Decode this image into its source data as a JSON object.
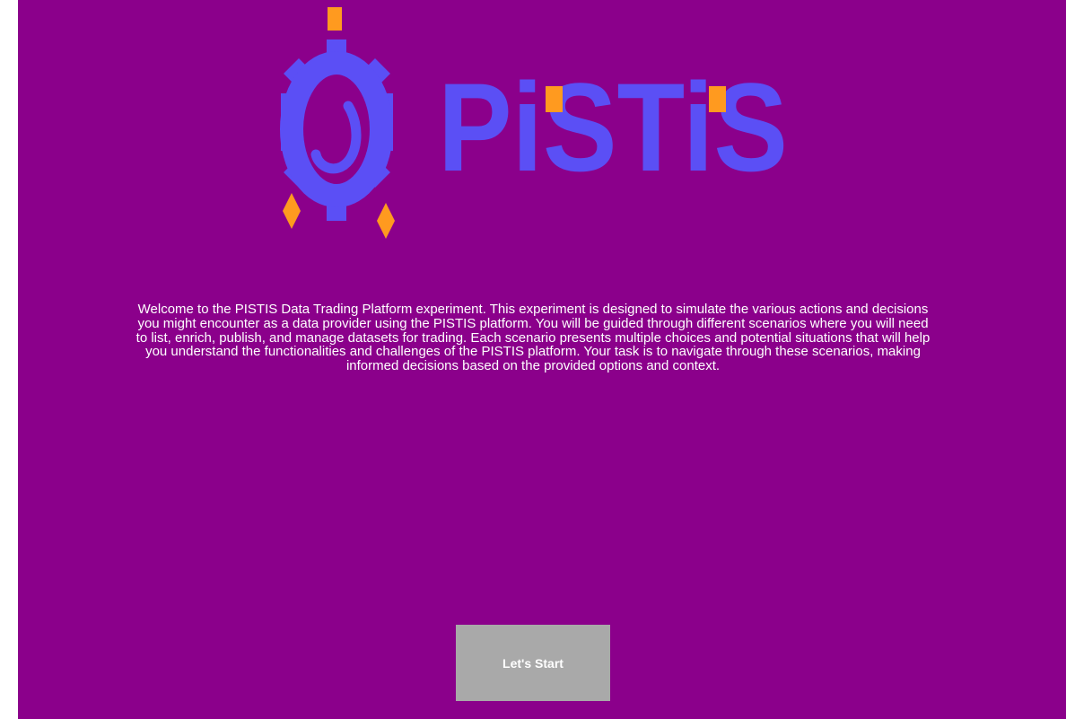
{
  "page": {
    "background_color": "#8b008b"
  },
  "logo": {
    "wordmark": "PiSTiS",
    "brand_color": "#5b4ff5",
    "accent_color": "#ff9a1f",
    "icon": "gear-icon"
  },
  "intro": {
    "text": "Welcome to the PISTIS Data Trading Platform experiment. This experiment is designed to simulate the various actions and decisions you might encounter as a data provider using the PISTIS platform. You will be guided through different scenarios where you will need to list, enrich, publish, and manage datasets for trading. Each scenario presents multiple choices and potential situations that will help you understand the functionalities and challenges of the PISTIS platform. Your task is to navigate through these scenarios, making informed decisions based on the provided options and context."
  },
  "start_button": {
    "label": "Let's Start",
    "color": "#a9a9a9"
  }
}
